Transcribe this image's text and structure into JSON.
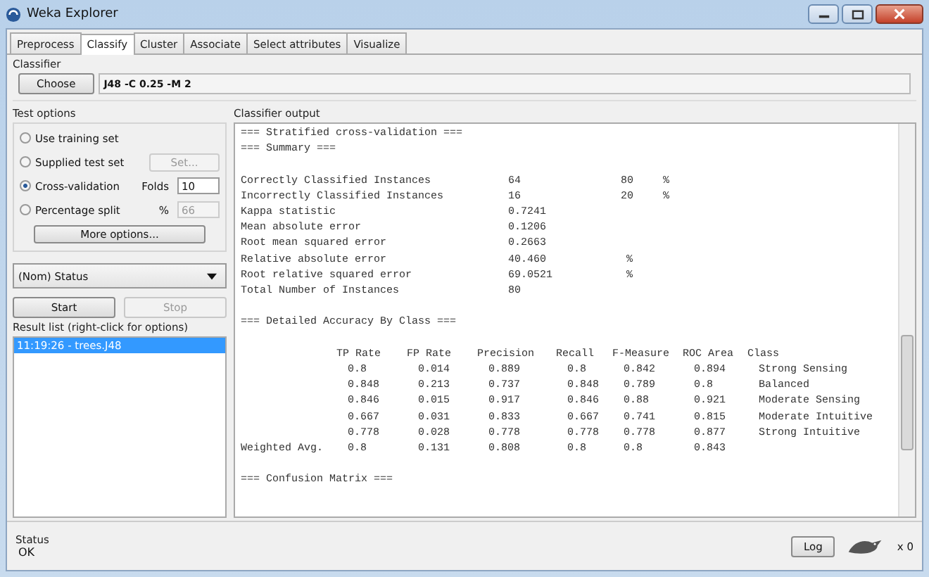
{
  "window": {
    "title": "Weka Explorer"
  },
  "tabs": [
    {
      "label": "Preprocess",
      "selected": false
    },
    {
      "label": "Classify",
      "selected": true
    },
    {
      "label": "Cluster",
      "selected": false
    },
    {
      "label": "Associate",
      "selected": false
    },
    {
      "label": "Select attributes",
      "selected": false
    },
    {
      "label": "Visualize",
      "selected": false
    }
  ],
  "classifier": {
    "title": "Classifier",
    "button": "Choose",
    "value": "J48 -C 0.25 -M 2"
  },
  "test_options": {
    "title": "Test options",
    "options": [
      {
        "label": "Use training set",
        "selected": false
      },
      {
        "label": "Supplied test set",
        "selected": false,
        "button": "Set..."
      },
      {
        "label": "Cross-validation",
        "selected": true,
        "field_label": "Folds",
        "value": "10"
      },
      {
        "label": "Percentage split",
        "selected": false,
        "field_label": "%",
        "value": "66"
      }
    ],
    "more": "More options..."
  },
  "class_select": "(Nom) Status",
  "start": "Start",
  "stop": "Stop",
  "result_list": {
    "title": "Result list (right-click for options)",
    "items": [
      {
        "label": "11:19:26 - trees.J48",
        "selected": true
      }
    ]
  },
  "output": {
    "title": "Classifier output",
    "headings": [
      "=== Stratified cross-validation ===",
      "=== Summary ==="
    ],
    "summary": [
      {
        "label": "Correctly Classified Instances",
        "value": "64",
        "percent": "80",
        "unit": "%"
      },
      {
        "label": "Incorrectly Classified Instances",
        "value": "16",
        "percent": "20",
        "unit": "%"
      },
      {
        "label": "Kappa statistic",
        "value": "0.7241"
      },
      {
        "label": "Mean absolute error",
        "value": "0.1206"
      },
      {
        "label": "Root mean squared error",
        "value": "0.2663"
      },
      {
        "label": "Relative absolute error",
        "value": "40.460",
        "unit": "%"
      },
      {
        "label": "Root relative squared error",
        "value": "69.0521",
        "unit": "%"
      },
      {
        "label": "Total Number of Instances",
        "value": "80"
      }
    ],
    "accuracy_heading": "=== Detailed Accuracy By Class ===",
    "columns": [
      "TP Rate",
      "FP Rate",
      "Precision",
      "Recall",
      "F-Measure",
      "ROC Area",
      "Class"
    ],
    "rows": [
      {
        "label": "",
        "cells": [
          "0.8",
          "0.014",
          "0.889",
          "0.8",
          "0.842",
          "0.894",
          "Strong Sensing"
        ]
      },
      {
        "label": "",
        "cells": [
          "0.848",
          "0.213",
          "0.737",
          "0.848",
          "0.789",
          "0.8",
          "Balanced"
        ]
      },
      {
        "label": "",
        "cells": [
          "0.846",
          "0.015",
          "0.917",
          "0.846",
          "0.88",
          "0.921",
          "Moderate Sensing"
        ]
      },
      {
        "label": "",
        "cells": [
          "0.667",
          "0.031",
          "0.833",
          "0.667",
          "0.741",
          "0.815",
          "Moderate Intuitive"
        ]
      },
      {
        "label": "",
        "cells": [
          "0.778",
          "0.028",
          "0.778",
          "0.778",
          "0.778",
          "0.877",
          "Strong Intuitive"
        ]
      },
      {
        "label": "Weighted Avg.",
        "cells": [
          "0.8",
          "0.131",
          "0.808",
          "0.8",
          "0.8",
          "0.843"
        ]
      }
    ],
    "matrix_heading": "=== Confusion Matrix ==="
  },
  "status": {
    "title": "Status",
    "text": "OK",
    "log": "Log",
    "count": "x 0"
  }
}
